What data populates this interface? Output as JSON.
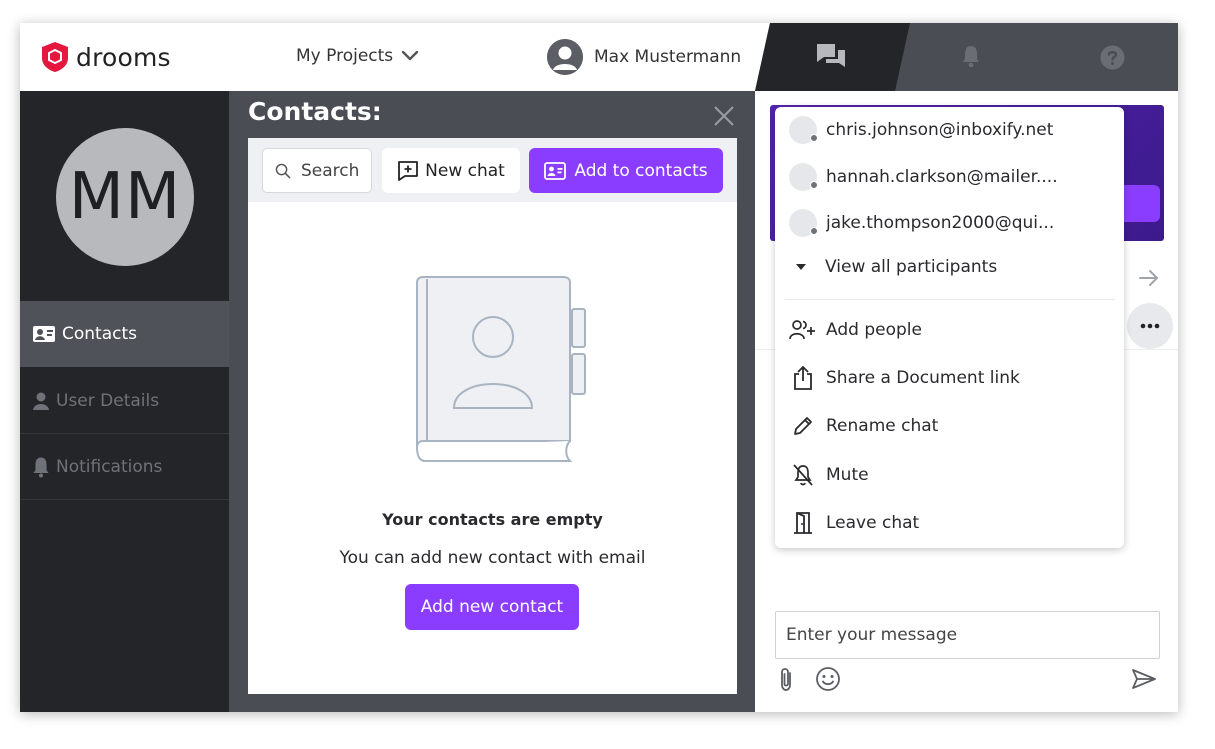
{
  "app": {
    "logo_text": "drooms",
    "brand_color": "#e5173f",
    "accent_color": "#8b3dff"
  },
  "header": {
    "projects_label": "My Projects",
    "user_name": "Max Mustermann",
    "tabs": [
      {
        "icon": "chat-icon",
        "active": true
      },
      {
        "icon": "bell-icon",
        "active": false
      },
      {
        "icon": "help-icon",
        "active": false
      }
    ]
  },
  "sidebar": {
    "avatar_initials": "MM",
    "items": [
      {
        "label": "Contacts",
        "icon": "contact-card-icon",
        "active": true
      },
      {
        "label": "User Details",
        "icon": "user-icon",
        "active": false
      },
      {
        "label": "Notifications",
        "icon": "bell-icon",
        "active": false
      }
    ]
  },
  "contacts": {
    "title": "Contacts:",
    "search_placeholder": "Search",
    "new_chat_label": "New chat",
    "add_to_contacts_label": "Add to contacts",
    "empty_title": "Your contacts are empty",
    "empty_subtitle": "You can add new contact with email",
    "add_new_label": "Add new contact"
  },
  "chat": {
    "message_placeholder": "Enter your message"
  },
  "menu": {
    "participants": [
      {
        "email": "chris.johnson@inboxify.net"
      },
      {
        "email": "hannah.clarkson@mailer...."
      },
      {
        "email": "jake.thompson2000@qui..."
      }
    ],
    "view_all_label": "View all participants",
    "items": [
      {
        "label": "Add people",
        "icon": "add-people-icon"
      },
      {
        "label": "Share a Document link",
        "icon": "share-icon"
      },
      {
        "label": "Rename chat",
        "icon": "pencil-icon"
      },
      {
        "label": "Mute",
        "icon": "mute-bell-icon"
      },
      {
        "label": "Leave chat",
        "icon": "door-exit-icon"
      }
    ]
  }
}
